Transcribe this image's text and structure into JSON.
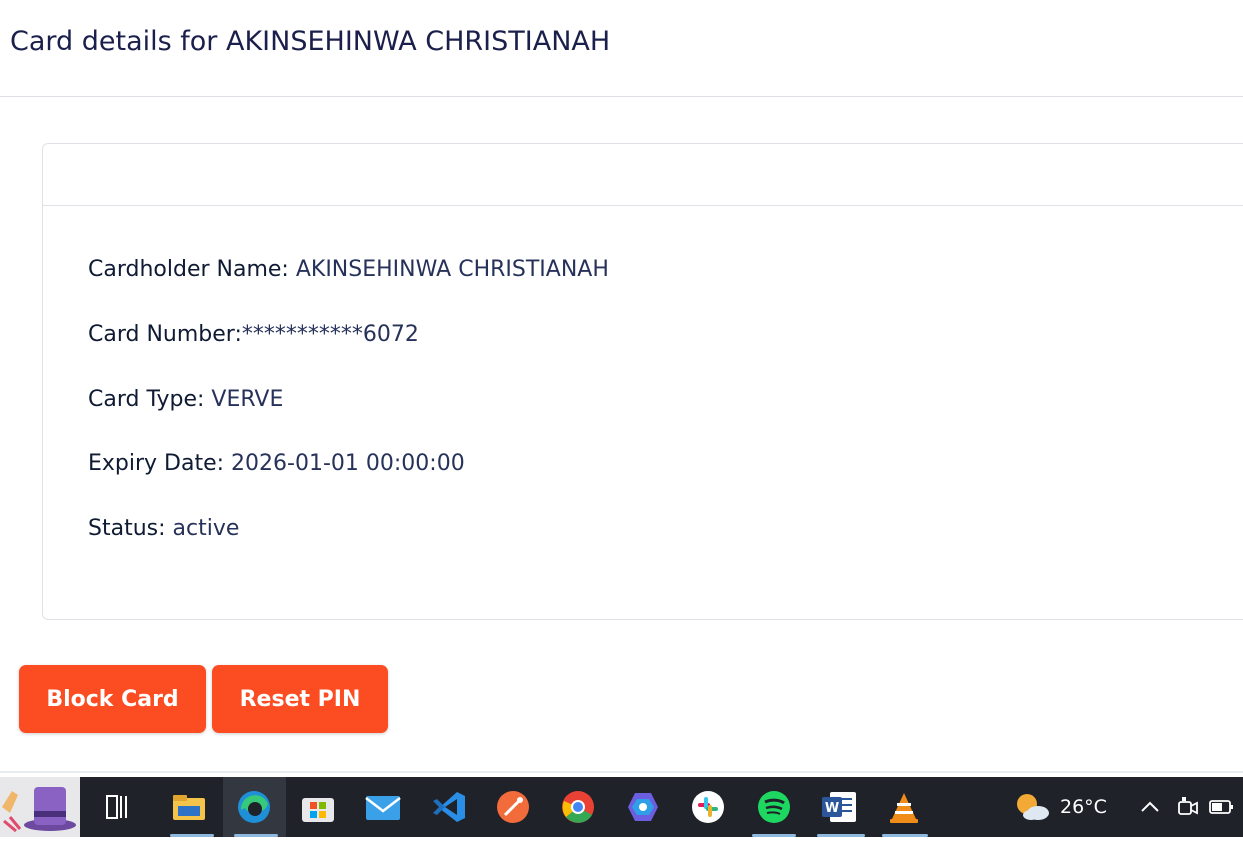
{
  "header": {
    "title": "Card details for AKINSEHINWA CHRISTIANAH"
  },
  "card": {
    "details": [
      {
        "label": "Cardholder Name:",
        "value": " AKINSEHINWA CHRISTIANAH"
      },
      {
        "label": "Card Number:",
        "value": "***********6072"
      },
      {
        "label": "Card Type:",
        "value": " VERVE"
      },
      {
        "label": "Expiry Date:",
        "value": " 2026-01-01 00:00:00"
      },
      {
        "label": "Status:",
        "value": " active"
      }
    ]
  },
  "actions": {
    "block_label": "Block Card",
    "reset_label": "Reset PIN"
  },
  "colors": {
    "accent": "#fc4c22",
    "taskbar": "#1f2229"
  },
  "taskbar": {
    "apps": [
      "file-explorer-icon",
      "edge-icon",
      "store-icon",
      "mail-icon",
      "vscode-icon",
      "postman-icon",
      "chrome-icon",
      "copilot-icon",
      "slack-icon",
      "spotify-icon",
      "word-icon",
      "vlc-icon"
    ],
    "weather": {
      "temp": "26°C",
      "icon": "partly-cloudy-icon"
    }
  }
}
